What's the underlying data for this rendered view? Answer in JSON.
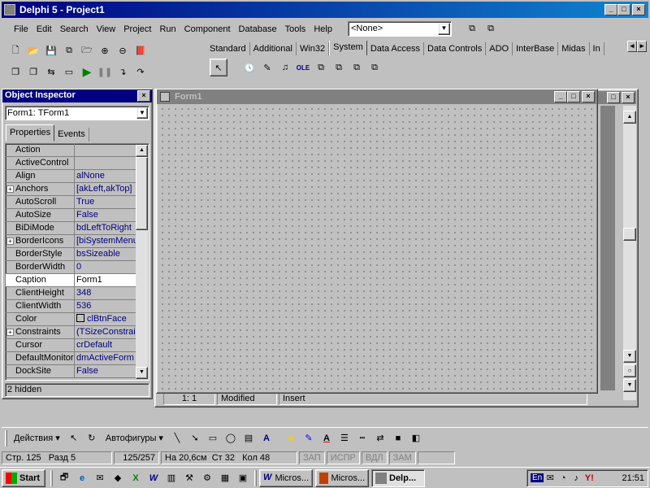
{
  "app": {
    "title": "Delphi 5 - Project1"
  },
  "menu": [
    "File",
    "Edit",
    "Search",
    "View",
    "Project",
    "Run",
    "Component",
    "Database",
    "Tools",
    "Help"
  ],
  "config_combo": "<None>",
  "palette_tabs": [
    "Standard",
    "Additional",
    "Win32",
    "System",
    "Data Access",
    "Data Controls",
    "ADO",
    "InterBase",
    "Midas",
    "In"
  ],
  "palette_active": "System",
  "object_inspector": {
    "title": "Object Inspector",
    "selector": "Form1: TForm1",
    "tabs": [
      "Properties",
      "Events"
    ],
    "properties": [
      {
        "name": "Action",
        "value": "",
        "plus": false
      },
      {
        "name": "ActiveControl",
        "value": "",
        "plus": false
      },
      {
        "name": "Align",
        "value": "alNone",
        "plus": false
      },
      {
        "name": "Anchors",
        "value": "[akLeft,akTop]",
        "plus": true
      },
      {
        "name": "AutoScroll",
        "value": "True",
        "plus": false
      },
      {
        "name": "AutoSize",
        "value": "False",
        "plus": false
      },
      {
        "name": "BiDiMode",
        "value": "bdLeftToRight",
        "plus": false
      },
      {
        "name": "BorderIcons",
        "value": "[biSystemMenu,",
        "plus": true
      },
      {
        "name": "BorderStyle",
        "value": "bsSizeable",
        "plus": false
      },
      {
        "name": "BorderWidth",
        "value": "0",
        "plus": false
      },
      {
        "name": "Caption",
        "value": "Form1",
        "plus": false,
        "selected": true
      },
      {
        "name": "ClientHeight",
        "value": "348",
        "plus": false
      },
      {
        "name": "ClientWidth",
        "value": "536",
        "plus": false
      },
      {
        "name": "Color",
        "value": "clBtnFace",
        "plus": false,
        "swatch": true
      },
      {
        "name": "Constraints",
        "value": "(TSizeConstrain",
        "plus": true
      },
      {
        "name": "Cursor",
        "value": "crDefault",
        "plus": false
      },
      {
        "name": "DefaultMonitor",
        "value": "dmActiveForm",
        "plus": false
      },
      {
        "name": "DockSite",
        "value": "False",
        "plus": false
      }
    ],
    "footer": "2 hidden"
  },
  "form": {
    "title": "Form1"
  },
  "editor_status": {
    "position": "1:   1",
    "modified": "Modified",
    "mode": "Insert"
  },
  "draw_toolbar": {
    "actions": "Действия",
    "autoshapes": "Автофигуры"
  },
  "word_status": {
    "page": "Стр. 125",
    "section": "Разд 5",
    "pages": "125/257",
    "at": "На 20,6см",
    "line": "Ст 32",
    "col": "Кол 48",
    "rec": "ЗАП",
    "trk": "ИСПР",
    "ext": "ВДЛ",
    "ovr": "ЗАМ"
  },
  "taskbar": {
    "start": "Start",
    "tasks": [
      "Micros...",
      "Micros...",
      "Delp..."
    ],
    "lang": "En",
    "clock": "21:51"
  }
}
